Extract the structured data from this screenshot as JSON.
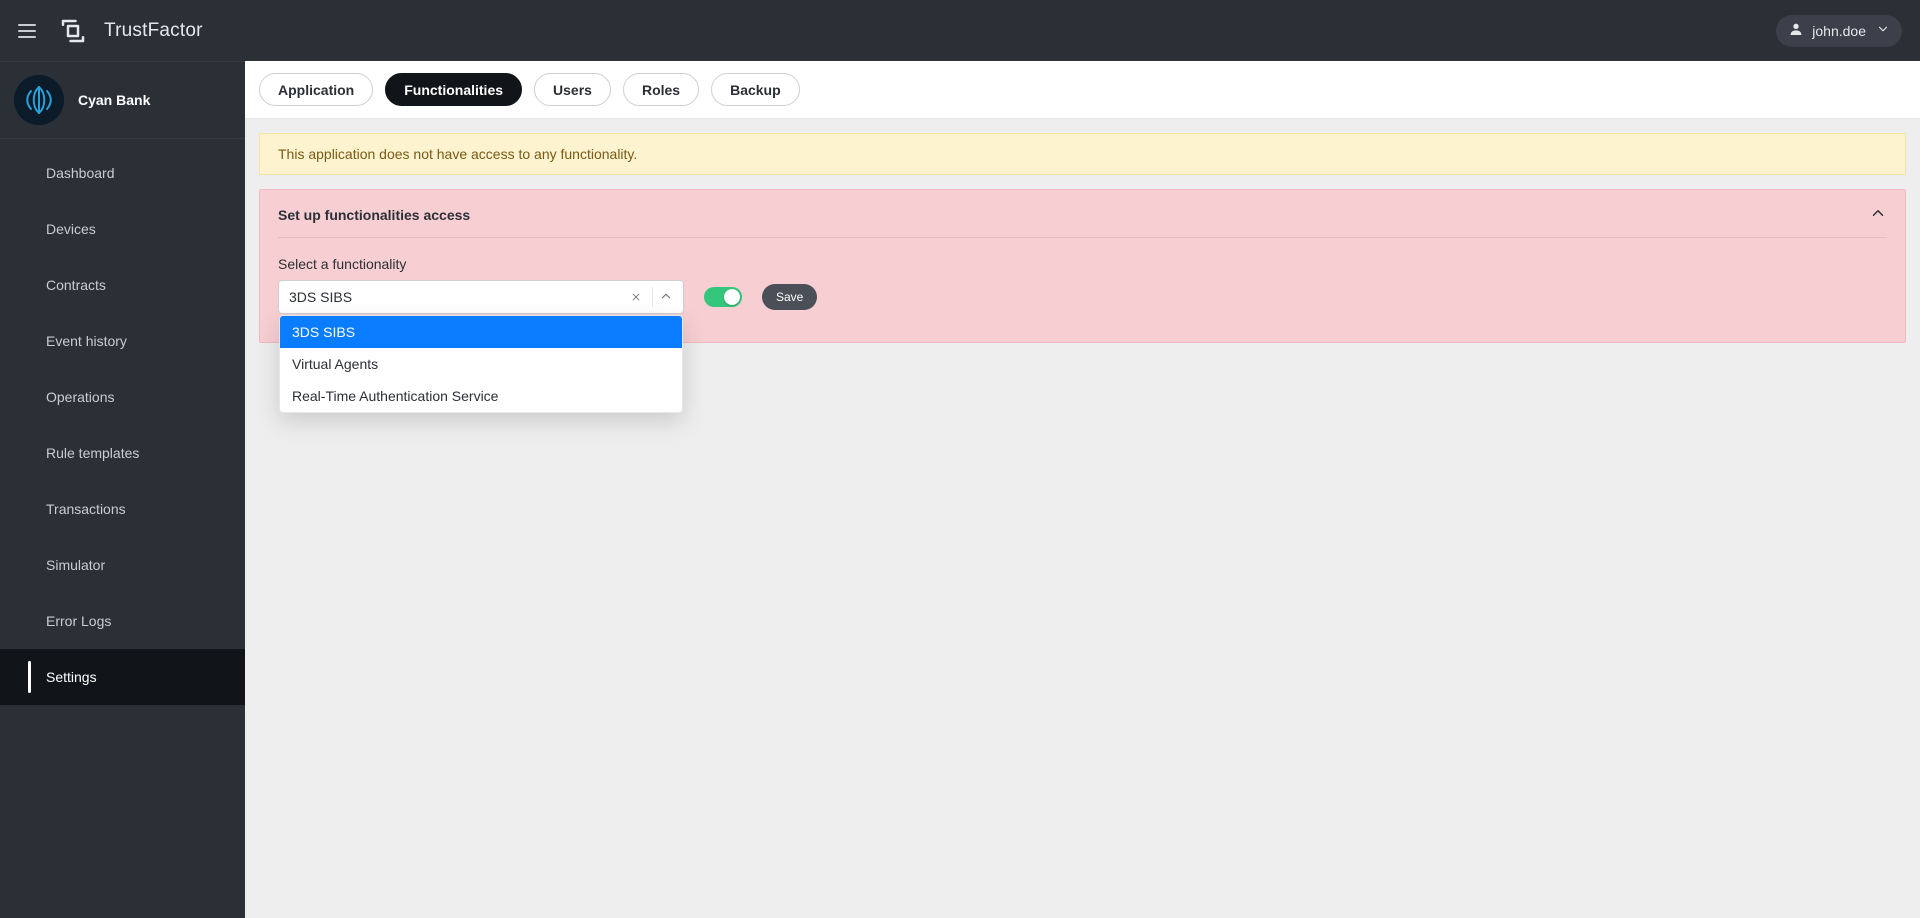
{
  "app": {
    "brand_name": "TrustFactor",
    "user_name": "john.doe"
  },
  "tenant": {
    "name": "Cyan Bank"
  },
  "sidebar": {
    "items": [
      {
        "label": "Dashboard",
        "active": false
      },
      {
        "label": "Devices",
        "active": false
      },
      {
        "label": "Contracts",
        "active": false
      },
      {
        "label": "Event history",
        "active": false
      },
      {
        "label": "Operations",
        "active": false
      },
      {
        "label": "Rule templates",
        "active": false
      },
      {
        "label": "Transactions",
        "active": false
      },
      {
        "label": "Simulator",
        "active": false
      },
      {
        "label": "Error Logs",
        "active": false
      },
      {
        "label": "Settings",
        "active": true
      }
    ]
  },
  "tabs": [
    {
      "label": "Application",
      "active": false
    },
    {
      "label": "Functionalities",
      "active": true
    },
    {
      "label": "Users",
      "active": false
    },
    {
      "label": "Roles",
      "active": false
    },
    {
      "label": "Backup",
      "active": false
    }
  ],
  "banner": {
    "warning_text": "This application does not have access to any functionality."
  },
  "panel": {
    "title": "Set up functionalities access",
    "field_label": "Select a functionality",
    "selected_value": "3DS SIBS",
    "options": [
      "3DS SIBS",
      "Virtual Agents",
      "Real-Time Authentication Service"
    ],
    "toggle_on": true,
    "save_label": "Save"
  }
}
